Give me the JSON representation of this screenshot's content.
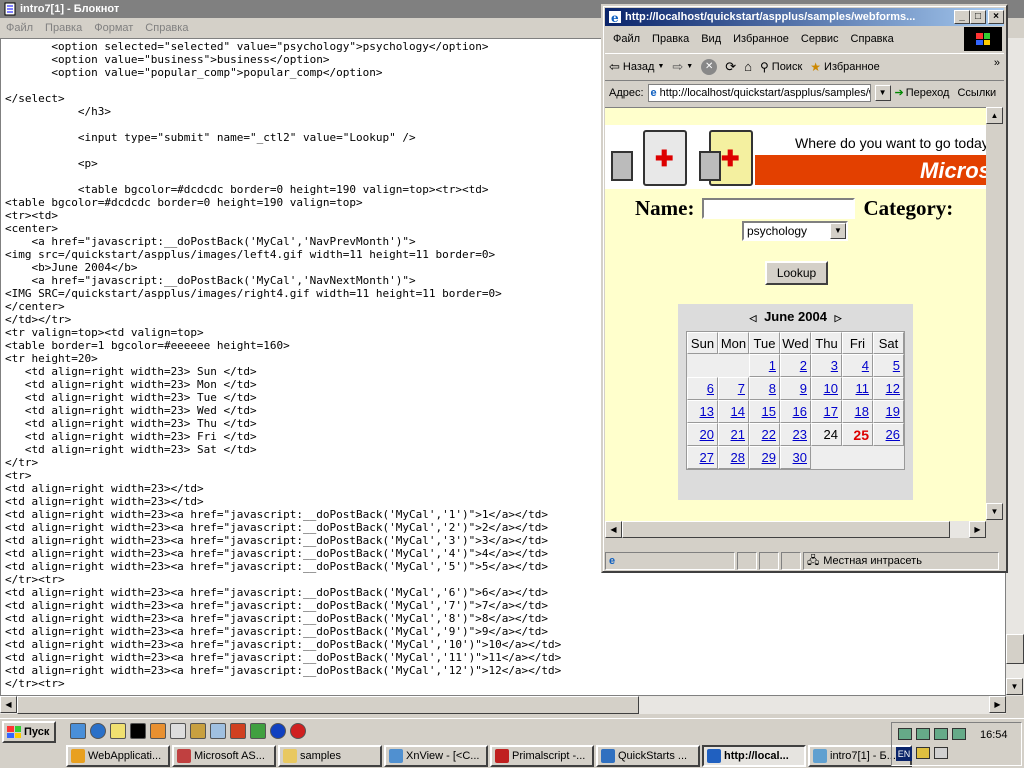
{
  "notepad": {
    "title": "intro7[1] - Блокнот",
    "menu": [
      "Файл",
      "Правка",
      "Формат",
      "Справка"
    ],
    "code_lines": [
      "       <option selected=\"selected\" value=\"psychology\">psychology</option>",
      "       <option value=\"business\">business</option>",
      "       <option value=\"popular_comp\">popular_comp</option>",
      "",
      "</select>",
      "           </h3>",
      "",
      "           <input type=\"submit\" name=\"_ctl2\" value=\"Lookup\" />",
      "",
      "           <p>",
      "",
      "           <table bgcolor=#dcdcdc border=0 height=190 valign=top><tr><td>",
      "<table bgcolor=#dcdcdc border=0 height=190 valign=top>",
      "<tr><td>",
      "<center>",
      "    <a href=\"javascript:__doPostBack('MyCal','NavPrevMonth')\">",
      "<img src=/quickstart/aspplus/images/left4.gif width=11 height=11 border=0>",
      "    <b>June 2004</b>",
      "    <a href=\"javascript:__doPostBack('MyCal','NavNextMonth')\">",
      "<IMG SRC=/quickstart/aspplus/images/right4.gif width=11 height=11 border=0>",
      "</center>",
      "</td></tr>",
      "<tr valign=top><td valign=top>",
      "<table border=1 bgcolor=#eeeeee height=160>",
      "<tr height=20>",
      "   <td align=right width=23> Sun </td>",
      "   <td align=right width=23> Mon </td>",
      "   <td align=right width=23> Tue </td>",
      "   <td align=right width=23> Wed </td>",
      "   <td align=right width=23> Thu </td>",
      "   <td align=right width=23> Fri </td>",
      "   <td align=right width=23> Sat </td>",
      "</tr>",
      "<tr>",
      "<td align=right width=23></td>",
      "<td align=right width=23></td>",
      "<td align=right width=23><a href=\"javascript:__doPostBack('MyCal','1')\">1</a></td>",
      "<td align=right width=23><a href=\"javascript:__doPostBack('MyCal','2')\">2</a></td>",
      "<td align=right width=23><a href=\"javascript:__doPostBack('MyCal','3')\">3</a></td>",
      "<td align=right width=23><a href=\"javascript:__doPostBack('MyCal','4')\">4</a></td>",
      "<td align=right width=23><a href=\"javascript:__doPostBack('MyCal','5')\">5</a></td>",
      "</tr><tr>",
      "<td align=right width=23><a href=\"javascript:__doPostBack('MyCal','6')\">6</a></td>",
      "<td align=right width=23><a href=\"javascript:__doPostBack('MyCal','7')\">7</a></td>",
      "<td align=right width=23><a href=\"javascript:__doPostBack('MyCal','8')\">8</a></td>",
      "<td align=right width=23><a href=\"javascript:__doPostBack('MyCal','9')\">9</a></td>",
      "<td align=right width=23><a href=\"javascript:__doPostBack('MyCal','10')\">10</a></td>",
      "<td align=right width=23><a href=\"javascript:__doPostBack('MyCal','11')\">11</a></td>",
      "<td align=right width=23><a href=\"javascript:__doPostBack('MyCal','12')\">12</a></td>",
      "</tr><tr>"
    ]
  },
  "ie": {
    "title": "http://localhost/quickstart/aspplus/samples/webforms...",
    "menu": [
      "Файл",
      "Правка",
      "Вид",
      "Избранное",
      "Сервис",
      "Справка"
    ],
    "toolbar": {
      "back": "Назад",
      "search": "Поиск",
      "favorites": "Избранное"
    },
    "address_label": "Адрес:",
    "address_value": "http://localhost/quickstart/aspplus/samples/webforms",
    "go_label": "Переход",
    "links_label": "Ссылки",
    "banner_tagline": "Where do you want to go today?",
    "banner_brand": "Microsoft",
    "form": {
      "name_label": "Name:",
      "category_label": "Category:",
      "category_value": "psychology",
      "lookup_label": "Lookup"
    },
    "calendar": {
      "month": "June 2004",
      "dow": [
        "Sun",
        "Mon",
        "Tue",
        "Wed",
        "Thu",
        "Fri",
        "Sat"
      ],
      "weeks": [
        [
          "",
          "",
          "1",
          "2",
          "3",
          "4",
          "5"
        ],
        [
          "6",
          "7",
          "8",
          "9",
          "10",
          "11",
          "12"
        ],
        [
          "13",
          "14",
          "15",
          "16",
          "17",
          "18",
          "19"
        ],
        [
          "20",
          "21",
          "22",
          "23",
          "24",
          "25",
          "26"
        ],
        [
          "27",
          "28",
          "29",
          "30",
          "",
          "",
          ""
        ]
      ],
      "today": "25",
      "plain_days": [
        "24"
      ]
    },
    "status_zone": "Местная интрасеть"
  },
  "taskbar": {
    "start_label": "Пуск",
    "tasks": [
      {
        "label": "WebApplicati...",
        "icon_color": "#e8a020",
        "active": false
      },
      {
        "label": "Microsoft AS...",
        "icon_color": "#c04040",
        "active": false
      },
      {
        "label": "samples",
        "icon_color": "#e8c860",
        "active": false
      },
      {
        "label": "XnView - [<C...",
        "icon_color": "#5090d0",
        "active": false
      },
      {
        "label": "Primalscript -...",
        "icon_color": "#c02020",
        "active": false
      },
      {
        "label": "QuickStarts ...",
        "icon_color": "#3070c0",
        "active": false
      },
      {
        "label": "http://local...",
        "icon_color": "#2060c0",
        "active": true
      },
      {
        "label": "intro7[1] - Б...",
        "icon_color": "#60a0d0",
        "active": false
      }
    ],
    "time": "16:54",
    "lang": "EN"
  }
}
